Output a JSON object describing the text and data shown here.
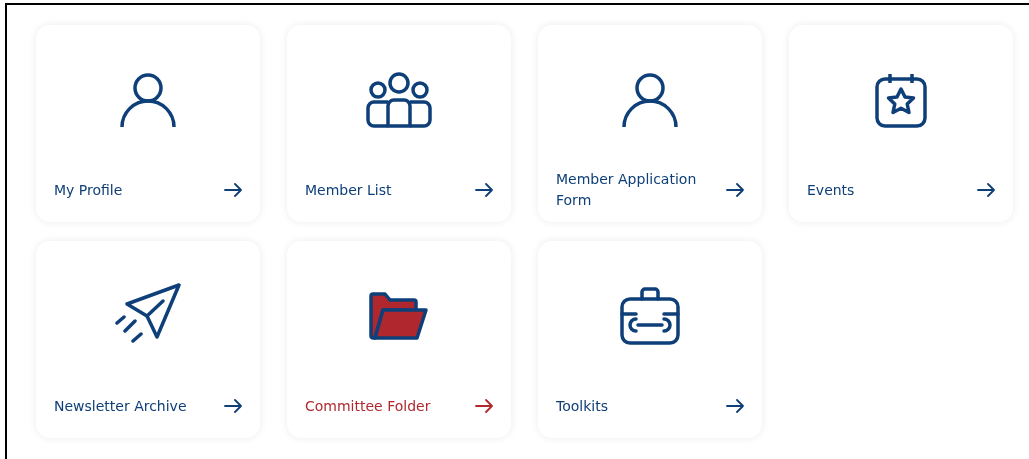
{
  "tiles": [
    {
      "kind": "person",
      "label": "My Profile",
      "selected": false
    },
    {
      "kind": "group",
      "label": "Member List",
      "selected": false
    },
    {
      "kind": "person",
      "label": "Member Application Form",
      "selected": false
    },
    {
      "kind": "calendar",
      "label": "Events",
      "selected": false
    },
    {
      "kind": "plane",
      "label": "Newsletter Archive",
      "selected": false
    },
    {
      "kind": "folder",
      "label": "Committee Folder",
      "selected": true
    },
    {
      "kind": "toolbox",
      "label": "Toolkits",
      "selected": false
    }
  ]
}
